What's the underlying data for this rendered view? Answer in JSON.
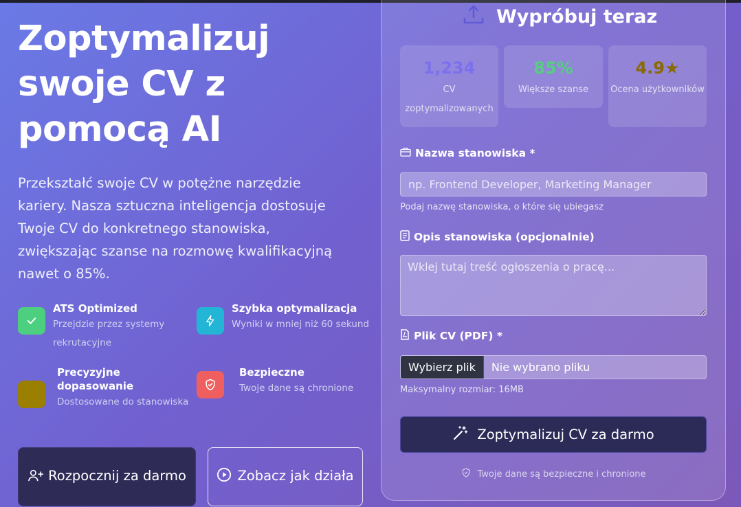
{
  "hero": {
    "title": "Zoptymalizuj swoje CV z pomocą AI",
    "description": "Przekształć swoje CV w potężne narzędzie kariery. Nasza sztuczna inteligencja dostosuje Twoje CV do konkretnego stanowiska, zwiększając szanse na rozmowę kwalifikacyjną nawet o 85%."
  },
  "features": [
    {
      "title": "ATS Optimized",
      "desc": "Przejdzie przez systemy rekrutacyjne",
      "icon": "check-icon",
      "color": "#4ccf7e"
    },
    {
      "title": "Szybka optymalizacja",
      "desc": "Wyniki w mniej niż 60 sekund",
      "icon": "bolt-icon",
      "color": "#22b5d6"
    },
    {
      "title": "Precyzyjne dopasowanie",
      "desc": "Dostosowane do stanowiska",
      "icon": "target-icon",
      "color": "#9a7f00"
    },
    {
      "title": "Bezpieczne",
      "desc": "Twoje dane są chronione",
      "icon": "shield-icon",
      "color": "#ef5f5f"
    }
  ],
  "actions": {
    "start": "Rozpocznij za darmo",
    "demo": "Zobacz jak działa"
  },
  "card": {
    "title": "Wypróbuj teraz",
    "stats": [
      {
        "value": "1,234",
        "label": "CV zoptymalizowanych",
        "color": "#7c70ee"
      },
      {
        "value": "85%",
        "label": "Większe szanse",
        "color": "#55d07e"
      },
      {
        "value": "4.9★",
        "label": "Ocena użytkowników",
        "color": "#8a6a00"
      }
    ],
    "job_title_label": "Nazwa stanowiska *",
    "job_title_placeholder": "np. Frontend Developer, Marketing Manager",
    "job_title_hint": "Podaj nazwę stanowiska, o które się ubiegasz",
    "job_desc_label": "Opis stanowiska (opcjonalnie)",
    "job_desc_placeholder": "Wklej tutaj treść ogłoszenia o pracę...",
    "file_label": "Plik CV (PDF) *",
    "file_button": "Wybierz plik",
    "file_status": "Nie wybrano pliku",
    "file_hint": "Maksymalny rozmiar: 16MB",
    "submit": "Zoptymalizuj CV za darmo",
    "secure_note": "Twoje dane są bezpieczne i chronione"
  }
}
